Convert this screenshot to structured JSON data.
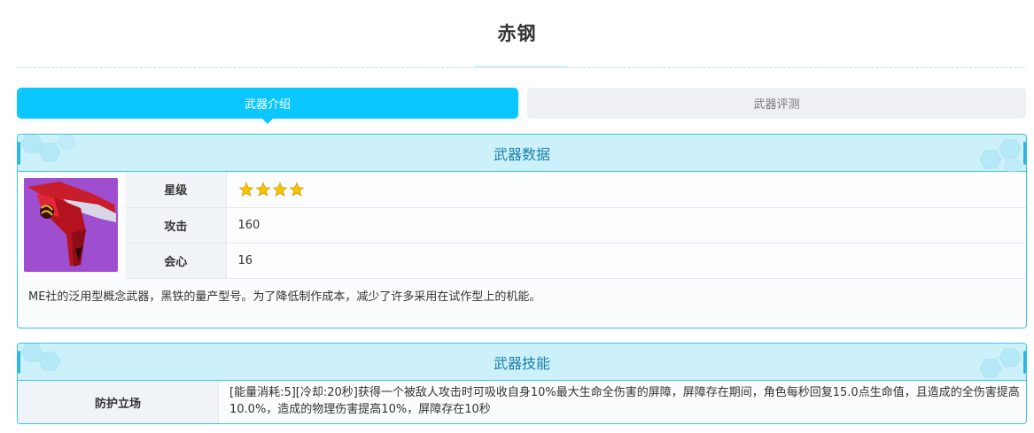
{
  "page": {
    "title": "赤钢"
  },
  "tabs": [
    {
      "label": "武器介绍",
      "active": true
    },
    {
      "label": "武器评测",
      "active": false
    }
  ],
  "weapon_data": {
    "header": "武器数据",
    "image_icon": "weapon-blade-icon",
    "stats": [
      {
        "label": "星级",
        "value": "",
        "stars": 4
      },
      {
        "label": "攻击",
        "value": "160"
      },
      {
        "label": "会心",
        "value": "16"
      }
    ],
    "description": "ME社的泛用型概念武器，黑铁的量产型号。为了降低制作成本，减少了许多采用在试作型上的机能。"
  },
  "weapon_skill": {
    "header": "武器技能",
    "name": "防护立场",
    "text": "[能量消耗:5][冷却:20秒]获得一个被敌人攻击时可吸收自身10%最大生命全伤害的屏障，屏障存在期间，角色每秒回复15.0点生命值，且造成的全伤害提高10.0%，造成的物理伤害提高10%，屏障存在10秒"
  },
  "colors": {
    "accent": "#0bc6ff",
    "panel_border": "#38c3e3",
    "panel_header_bg": "#ccf1fb",
    "header_text": "#1a7fa8",
    "star": "#f5c400",
    "weapon_bg": "#a04ed0"
  }
}
